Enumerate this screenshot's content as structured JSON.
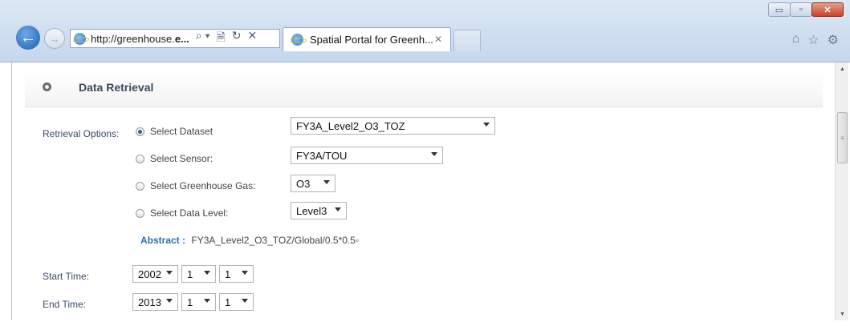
{
  "browser": {
    "url_plain": "http://greenhouse.",
    "url_bold": "e...",
    "address_tools": [
      "⌕ ▾",
      "🗎",
      "↻",
      "✕"
    ],
    "tab_title": "Spatial Portal for Greenh...",
    "tab_close": "✕",
    "window_buttons": [
      "▭",
      "▫",
      "✕"
    ],
    "toolbar_icons": [
      "⌂",
      "☆",
      "⚙"
    ]
  },
  "panel": {
    "title": "Data Retrieval"
  },
  "form": {
    "retrieval_label": "Retrieval Options:",
    "options": [
      {
        "label": "Select Dataset",
        "checked": true,
        "value": "FY3A_Level2_O3_TOZ"
      },
      {
        "label": "Select Sensor:",
        "checked": false,
        "value": "FY3A/TOU"
      },
      {
        "label": "Select Greenhouse Gas:",
        "checked": false,
        "value": "O3"
      },
      {
        "label": "Select Data Level:",
        "checked": false,
        "value": "Level3"
      }
    ],
    "abstract_label": "Abstract :",
    "abstract_value": "FY3A_Level2_O3_TOZ/Global/0.5*0.5",
    "abstract_suffix": "◦",
    "start_label": "Start Time:",
    "start": {
      "year": "2002",
      "month": "1",
      "day": "1"
    },
    "end_label": "End Time:",
    "end": {
      "year": "2013",
      "month": "1",
      "day": "1"
    }
  }
}
